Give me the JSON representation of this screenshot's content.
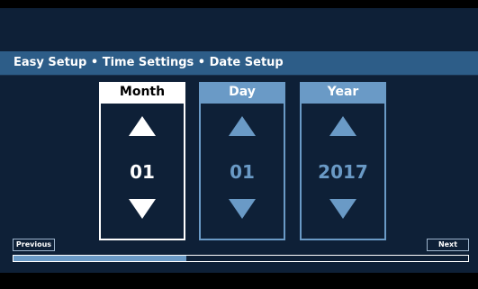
{
  "header": {
    "title": "Easy Setup • Time Settings • Date Setup"
  },
  "columns": [
    {
      "label": "Month",
      "value": "01",
      "state": "active"
    },
    {
      "label": "Day",
      "value": "01",
      "state": "inactive"
    },
    {
      "label": "Year",
      "value": "2017",
      "state": "inactive"
    }
  ],
  "icons": {
    "increment": "triangle-up-icon",
    "decrement": "triangle-down-icon"
  },
  "footer": {
    "previous_label": "Previous",
    "next_label": "Next",
    "progress_fraction": 0.38
  },
  "colors": {
    "background": "#0e2037",
    "title_bar": "#2d5d88",
    "active": "#ffffff",
    "inactive": "#6a9ac6"
  }
}
